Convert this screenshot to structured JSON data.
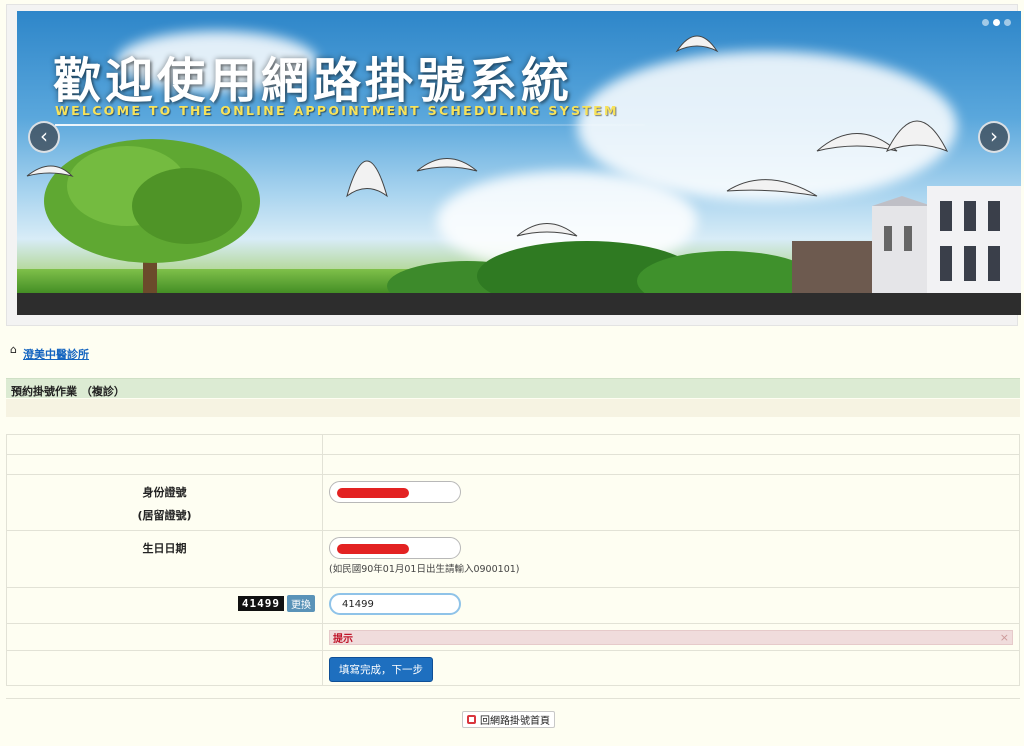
{
  "banner": {
    "title": "歡迎使用網路掛號系統",
    "subtitle": "WELCOME TO THE ONLINE APPOINTMENT SCHEDULING SYSTEM",
    "prev_arrow": "‹",
    "next_arrow": "›"
  },
  "breadcrumb": {
    "home_icon": "⌂",
    "clinic_name": "澄美中醫診所"
  },
  "section": {
    "title": "預約掛號作業 （複診）"
  },
  "form": {
    "id_label": "身份證號",
    "id_label_sub": "(居留證號)",
    "birthday_label": "生日日期",
    "birthday_hint": "(如民國90年01月01日出生請輸入0900101)",
    "captcha_code": "41499",
    "refresh_label": "更換",
    "captcha_value": "41499",
    "alert_title": "提示",
    "alert_close": "×",
    "submit_label": "填寫完成，下一步"
  },
  "footer": {
    "home_link": "回網路掛號首頁"
  },
  "colors": {
    "background": "#fefef2",
    "section_bar": "#dcebd3",
    "link": "#1565c0",
    "submit": "#1e6fbf",
    "alert_bg": "#f0dcdc",
    "alert_text": "#c0162b"
  }
}
